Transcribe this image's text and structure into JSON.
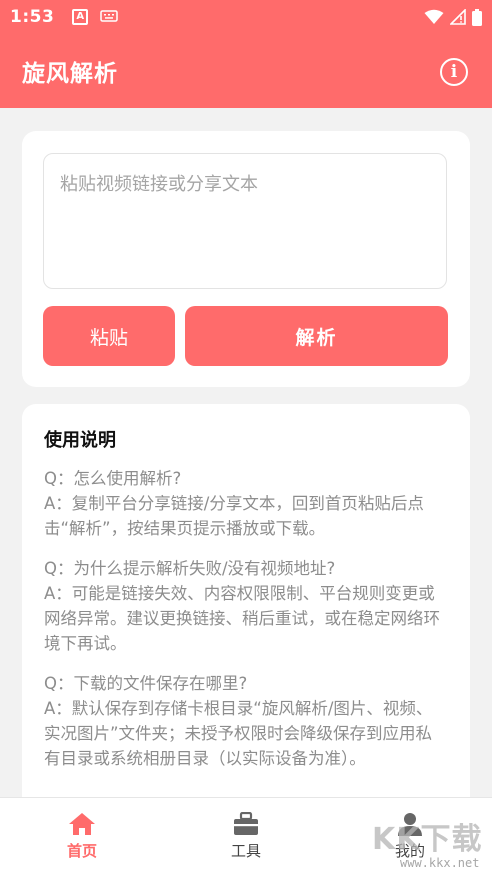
{
  "status_bar": {
    "time": "1:53",
    "notification_icon_letter": "A"
  },
  "header": {
    "title": "旋风解析",
    "info_icon": "i"
  },
  "input_card": {
    "placeholder": "粘贴视频链接或分享文本",
    "value": "",
    "paste_label": "粘贴",
    "parse_label": "解析"
  },
  "help": {
    "title": "使用说明",
    "faqs": [
      {
        "q": "Q：怎么使用解析?",
        "a": "A：复制平台分享链接/分享文本，回到首页粘贴后点击“解析”，按结果页提示播放或下载。"
      },
      {
        "q": "Q：为什么提示解析失败/没有视频地址?",
        "a": "A：可能是链接失效、内容权限限制、平台规则变更或网络异常。建议更换链接、稍后重试，或在稳定网络环境下再试。"
      },
      {
        "q": "Q：下载的文件保存在哪里?",
        "a": "A：默认保存到存储卡根目录“旋风解析/图片、视频、实况图片”文件夹；未授予权限时会降级保存到应用私有目录或系统相册目录（以实际设备为准）。"
      }
    ]
  },
  "bottom_nav": {
    "items": [
      {
        "label": "首页",
        "icon": "home-icon",
        "active": true
      },
      {
        "label": "工具",
        "icon": "toolbox-icon",
        "active": false
      },
      {
        "label": "我的",
        "icon": "person-icon",
        "active": false
      }
    ]
  },
  "watermark": {
    "logo": "KK下载",
    "url": "www.kkx.net"
  },
  "colors": {
    "accent": "#ff6b6b",
    "background": "#f2f2f2",
    "card": "#ffffff"
  }
}
